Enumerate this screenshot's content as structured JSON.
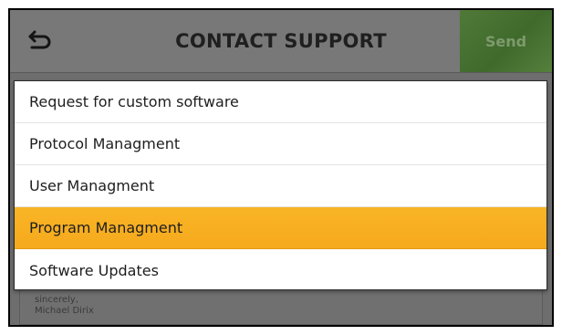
{
  "header": {
    "title": "CONTACT SUPPORT",
    "send_label": "Send",
    "back_icon": "back-arrow-icon"
  },
  "message": {
    "signature_line1": "sincerely,",
    "signature_line2": "Michael Dirix"
  },
  "dropdown": {
    "selected": "Program Managment",
    "options": [
      {
        "label": "Request for custom software"
      },
      {
        "label": "Protocol Managment"
      },
      {
        "label": "User Managment"
      },
      {
        "label": "Program Managment"
      },
      {
        "label": "Software Updates"
      }
    ]
  },
  "colors": {
    "accent_selected": "#f7ad20",
    "send_button": "#4a7534",
    "overlay": "#6b6b6b"
  }
}
